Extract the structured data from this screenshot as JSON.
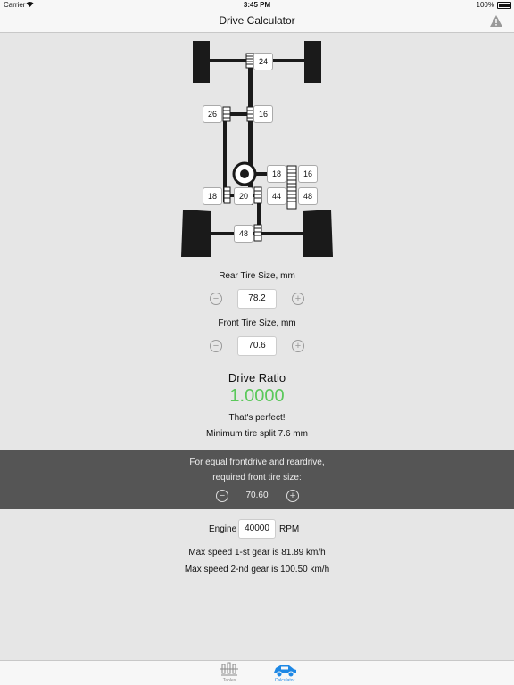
{
  "status_bar": {
    "carrier": "Carrier",
    "time": "3:45 PM",
    "battery": "100%"
  },
  "nav": {
    "title": "Drive Calculator",
    "warning_icon": "warning-triangle-icon"
  },
  "diagram": {
    "gears": {
      "rear_axle": "24",
      "mid_left": "26",
      "mid_right": "16",
      "motor_gear": "18",
      "motor_right": "16",
      "lower_left": "18",
      "lower_mid": "20",
      "lower_right": "44",
      "lower_far_right": "48",
      "front_axle": "48"
    }
  },
  "rear_tire": {
    "label": "Rear  Tire  Size,  mm",
    "value": "78.2"
  },
  "front_tire": {
    "label": "Front  Tire  Size,  mm",
    "value": "70.6"
  },
  "ratio": {
    "title": "Drive  Ratio",
    "value": "1.0000",
    "message": "That's perfect!",
    "split": "Minimum tire split 7.6 mm",
    "color": "#5ac85a"
  },
  "equal_panel": {
    "line1": "For equal frontdrive and reardrive,",
    "line2": "required front tire size:",
    "value": "70.60"
  },
  "engine": {
    "label": "Engine",
    "value": "40000",
    "unit": "RPM"
  },
  "speeds": {
    "gear1": "Max speed 1-st gear is 81.89 km/h",
    "gear2": "Max speed 2-nd gear is 100.50 km/h"
  },
  "tabs": [
    {
      "label": "Tables",
      "icon": "tables-icon"
    },
    {
      "label": "Calculator",
      "icon": "car-icon"
    }
  ],
  "accent_color": "#1e88e5"
}
